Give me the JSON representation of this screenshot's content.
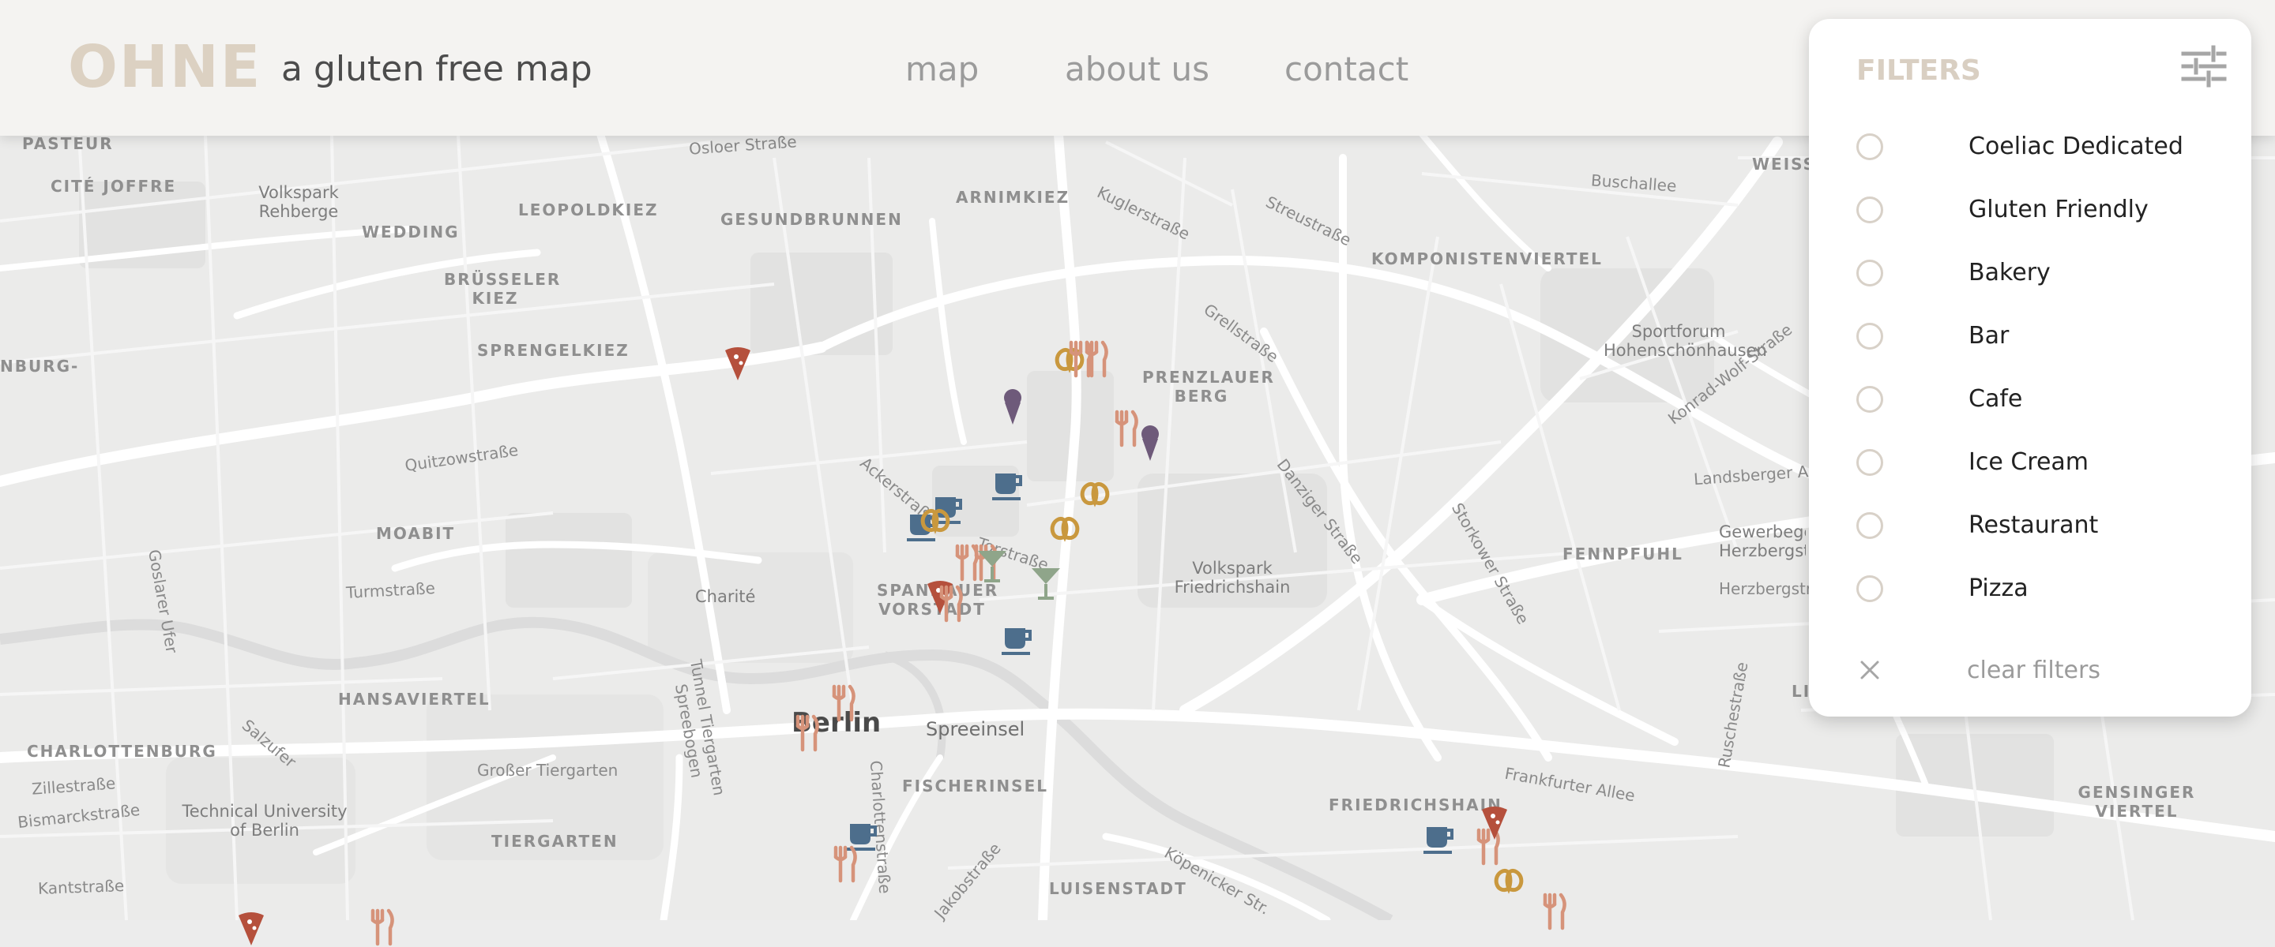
{
  "header": {
    "logo": "OHNE",
    "tagline": "a gluten free map",
    "nav": [
      {
        "label": "map"
      },
      {
        "label": "about us"
      },
      {
        "label": "contact"
      }
    ]
  },
  "filters": {
    "title": "FILTERS",
    "options": [
      {
        "label": "Coeliac Dedicated",
        "checked": false
      },
      {
        "label": "Gluten Friendly",
        "checked": false
      },
      {
        "label": "Bakery",
        "checked": false
      },
      {
        "label": "Bar",
        "checked": false
      },
      {
        "label": "Cafe",
        "checked": false
      },
      {
        "label": "Ice Cream",
        "checked": false
      },
      {
        "label": "Restaurant",
        "checked": false
      },
      {
        "label": "Pizza",
        "checked": false
      }
    ],
    "clear_label": "clear filters"
  },
  "map": {
    "city_label": "Berlin",
    "district_label": "Spreeinsel",
    "neighborhoods": [
      {
        "text": "PASTEUR"
      },
      {
        "text": "CITÉ JOFFRE"
      },
      {
        "text": "WEDDING"
      },
      {
        "text": "LEOPOLDKIEZ"
      },
      {
        "text": "GESUNDBRUNNEN"
      },
      {
        "text": "ARNIMKIEZ"
      },
      {
        "text": "WEISSENSEE"
      },
      {
        "text": "KOMPONISTENVIERTEL"
      },
      {
        "text": "BRÜSSELER KIEZ"
      },
      {
        "text": "SPRENGELKIEZ"
      },
      {
        "text": "PRENZLAUER BERG"
      },
      {
        "text": "MOABIT"
      },
      {
        "text": "SPANDAUER VORSTADT"
      },
      {
        "text": "HANSAVIERTEL"
      },
      {
        "text": "CHARLOTTENBURG"
      },
      {
        "text": "FISCHERINSEL"
      },
      {
        "text": "TIERGARTEN"
      },
      {
        "text": "LUISENSTADT"
      },
      {
        "text": "FRIEDRICHSHAIN"
      },
      {
        "text": "FENNPFUHL"
      },
      {
        "text": "LICHTE"
      },
      {
        "text": "GENSINGER VIERTEL"
      },
      {
        "text": "NBURG-"
      }
    ],
    "parks": [
      {
        "text": "Volkspark Rehberge"
      },
      {
        "text": "Charité"
      },
      {
        "text": "Volkspark Friedrichshain"
      },
      {
        "text": "Sportforum Hohenschönhausen"
      },
      {
        "text": "Technical University of Berlin"
      },
      {
        "text": "Gewerbegebi Herzbergstr"
      }
    ],
    "streets": [
      {
        "text": "Quitzowstraße"
      },
      {
        "text": "Turmstraße"
      },
      {
        "text": "Großer Tiergarten"
      },
      {
        "text": "Zillestraße"
      },
      {
        "text": "Bismarckstraße"
      },
      {
        "text": "Kantstraße"
      },
      {
        "text": "Salzufer"
      },
      {
        "text": "Goslarer Ufer"
      },
      {
        "text": "Tunnel Tiergarten Spreebogen"
      },
      {
        "text": "Torstraße"
      },
      {
        "text": "Ackerstraße"
      },
      {
        "text": "Kuglerstraße"
      },
      {
        "text": "Streustraße"
      },
      {
        "text": "Grellstraße"
      },
      {
        "text": "Buschallee"
      },
      {
        "text": "Danziger Straße"
      },
      {
        "text": "Storkower Straße"
      },
      {
        "text": "Landsberger Al"
      },
      {
        "text": "Herzbergstraße"
      },
      {
        "text": "Konrad-Wolf-Straße"
      },
      {
        "text": "Frankfurter Allee"
      },
      {
        "text": "Ruschestraße"
      },
      {
        "text": "Köpenicker Str."
      },
      {
        "text": "Jakobstraße"
      },
      {
        "text": "Charlottenstraße"
      },
      {
        "text": "Osloer Straße"
      }
    ],
    "marker_categories": [
      "pizza",
      "bakery",
      "restaurant",
      "ice-cream",
      "cafe",
      "bar"
    ],
    "colors": {
      "pizza": "#b5503c",
      "bakery": "#c9983e",
      "restaurant": "#d6937a",
      "ice_cream": "#6e5a7a",
      "cafe": "#4d6e8c",
      "bar": "#8fa58a",
      "brand": "#dcd1c2"
    }
  }
}
